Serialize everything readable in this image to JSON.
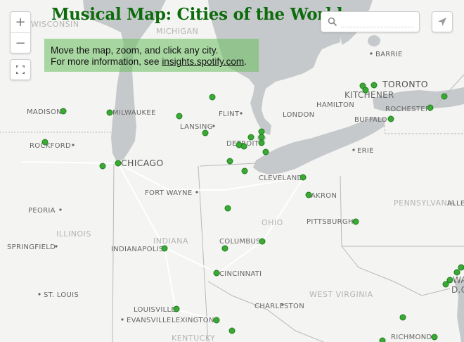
{
  "title": "Musical Map: Cities of the World",
  "info": {
    "line1": "Move the map, zoom, and click any city.",
    "line2_prefix": "For more information, see ",
    "link_text": "insights.spotify.com",
    "line2_suffix": "."
  },
  "controls": {
    "zoom_in": "+",
    "zoom_out": "−",
    "search_placeholder": "",
    "search_icon": "search-icon",
    "fullscreen_icon": "fullscreen-icon",
    "share_icon": "locate-arrow-icon"
  },
  "colors": {
    "water": "#c6c9cb",
    "land": "#f4f4f2",
    "dot": "#3aaa35",
    "title": "#0d6b0d"
  },
  "map": {
    "region_labels": [
      "WISCONSIN",
      "MICHIGAN",
      "ILLINOIS",
      "INDIANA",
      "OHIO",
      "PENNSYLVANIA",
      "WEST VIRGINIA",
      "KENTUCKY"
    ],
    "city_labels": [
      "MADISON",
      "MILWAUKEE",
      "ROCKFORD",
      "CHICAGO",
      "LANSING",
      "FLINT",
      "DETROIT",
      "LONDON",
      "HAMILTON",
      "KITCHENER",
      "TORONTO",
      "BARRIE",
      "ROCHESTER",
      "BUFFALO",
      "ERIE",
      "CLEVELAND",
      "AKRON",
      "FORT WAYNE",
      "PEORIA",
      "SPRINGFIELD",
      "INDIANAPOLIS",
      "COLUMBUS",
      "PITTSBURGH",
      "CINCINNATI",
      "ST. LOUIS",
      "LOUISVILLE",
      "EVANSVILLE",
      "LEXINGTON",
      "CHARLESTON",
      "RICHMOND",
      "ALLE",
      "WA",
      "D.C"
    ]
  }
}
